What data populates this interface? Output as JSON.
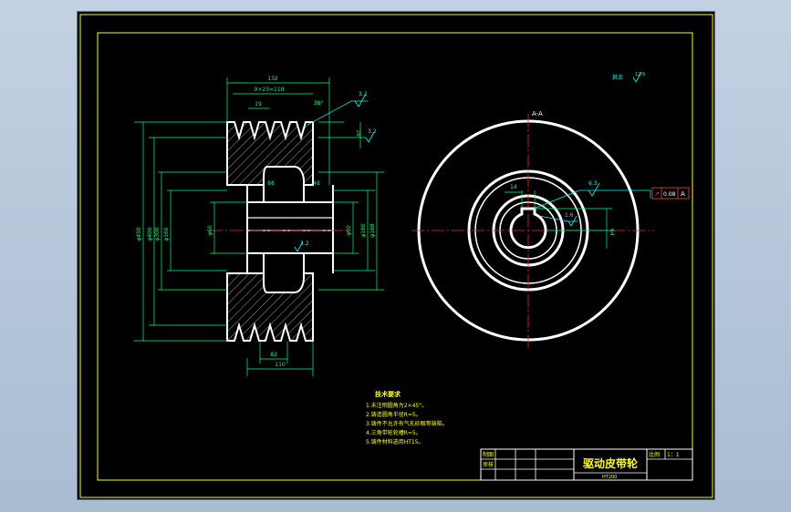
{
  "drawing": {
    "section_label": "A-A",
    "roughness_note_label": "其余",
    "roughness_note_value": "12.5",
    "colors": {
      "frame": "#ffff00",
      "outline": "#ffffff",
      "dimension": "#00ff7f",
      "centerline": "#ff2020",
      "hatch": "#c8c8c8",
      "tolerance": "#ff4040",
      "leader": "#00ffff"
    },
    "dims": {
      "overall_width": "132",
      "groove_pitch": "9×23=110",
      "groove_angle": "38°",
      "groove_top": "19",
      "groove_depth": "19",
      "hub_left": "88",
      "hub_right": "48",
      "bottom_width": "110",
      "bottom_offset": "82",
      "bore_roughness": "3.2",
      "rim_roughness": "3.2",
      "side_roughness": "3.2",
      "dia_outer": "φ450",
      "dia_rim": "φ400",
      "dia_web": "φ300",
      "dia_hub": "φ160",
      "dia_bore": "φ60",
      "dia_bore_r": "φ60",
      "dia_web_r": "φ180",
      "dia_rim_r": "φ188"
    },
    "front_view": {
      "keyway_width": "14",
      "keyway_depth": "64",
      "leader_roughness": "6.3",
      "leader_roughness2": "1.6",
      "tolerance_symbol": "↗",
      "tolerance_value": "0.08",
      "tolerance_datum": "A"
    },
    "technical_requirements": {
      "title": "技术要求",
      "items": [
        "1.未注明圆角为2×45°。",
        "2.铸造圆角半径R=5。",
        "3.铸件不允许有气孔砂眼等缺陷。",
        "4.三角带轮轮槽R=5。",
        "5.铸件材料选用HT15。"
      ]
    },
    "title_block": {
      "title": "驱动皮带轮",
      "row1_label": "制图",
      "row2_label": "审核",
      "scale_label": "比例",
      "scale_value": "1：1",
      "material": "HT200"
    }
  }
}
